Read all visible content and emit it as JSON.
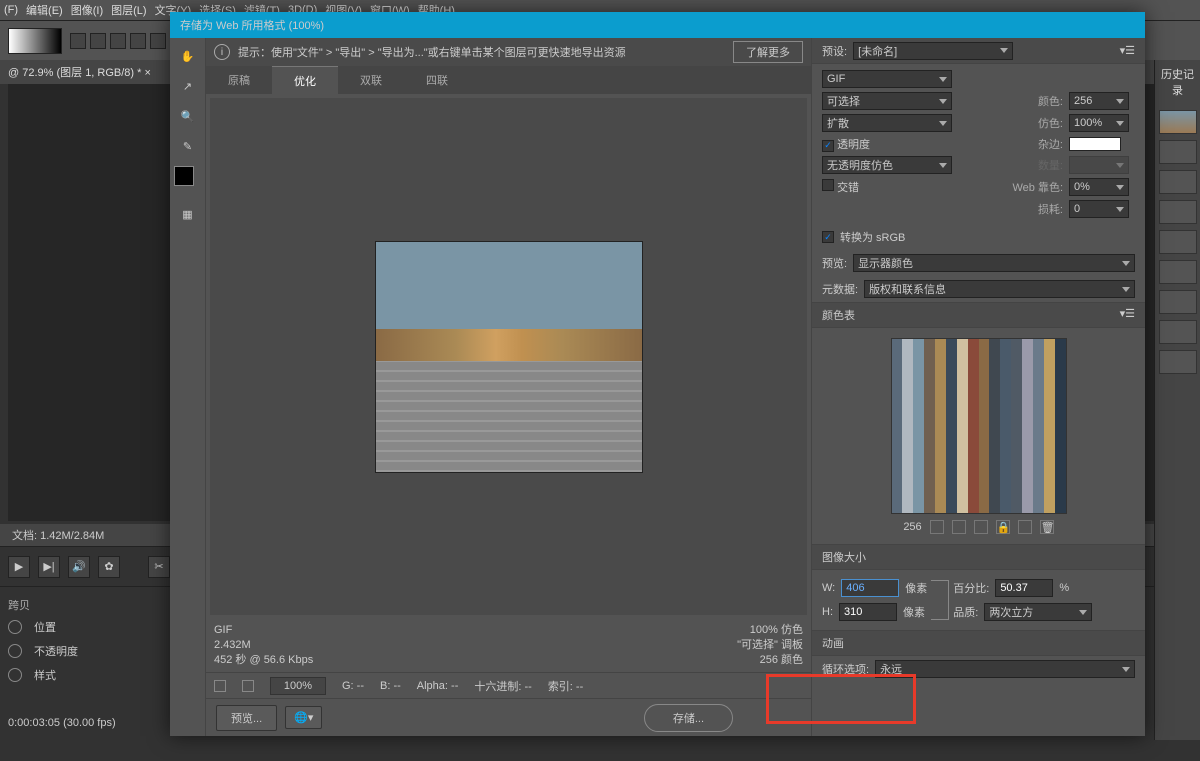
{
  "menubar": {
    "items": [
      "(F)",
      "编辑(E)",
      "图像(I)",
      "图层(L)",
      "文字(Y)",
      "选择(S)",
      "滤镜(T)",
      "3D(D)",
      "视图(V)",
      "窗口(W)",
      "帮助(H)"
    ]
  },
  "doc_tab": "@ 72.9% (图层 1, RGB/8) * ×",
  "status": "文档: 1.42M/2.84M",
  "right_panel_title": "历史记录",
  "timeline": {
    "tab": "跨贝",
    "rows": [
      "位置",
      "不透明度",
      "样式"
    ],
    "time": "0:00:03:05",
    "fps": "(30.00 fps)"
  },
  "dialog": {
    "title": "存储为 Web 所用格式 (100%)",
    "tip": "提示：使用\"文件\" > \"导出\" > \"导出为...\"或右键单击某个图层可更快速地导出资源",
    "learn_more": "了解更多",
    "tabs": [
      "原稿",
      "优化",
      "双联",
      "四联"
    ],
    "active_tab": 1,
    "info": {
      "format": "GIF",
      "size": "2.432M",
      "speed": "452 秒 @ 56.6 Kbps",
      "dither_pct": "100% 仿色",
      "palette": "\"可选择\" 调板",
      "colors": "256 颜色"
    },
    "zoom": "100%",
    "readout": {
      "g": "G: --",
      "b": "B: --",
      "alpha": "Alpha: --",
      "hex": "十六进制: --",
      "index": "索引: --"
    },
    "preview_btn": "预览...",
    "save_btn": "存储..."
  },
  "options": {
    "preset_label": "预设:",
    "preset_value": "[未命名]",
    "format": "GIF",
    "reduction": "可选择",
    "dither_method": "扩散",
    "colors_label": "颜色:",
    "colors": "256",
    "dither_label": "仿色:",
    "dither": "100%",
    "transparency": "透明度",
    "matte_label": "杂边:",
    "trans_dither": "无透明度仿色",
    "amount_label": "数量:",
    "interlace": "交错",
    "web_snap_label": "Web 靠色:",
    "web_snap": "0%",
    "lossy_label": "损耗:",
    "lossy": "0",
    "convert_srgb": "转换为 sRGB",
    "preview_label": "预览:",
    "preview_value": "显示器颜色",
    "metadata_label": "元数据:",
    "metadata_value": "版权和联系信息",
    "color_table_title": "颜色表",
    "color_count": "256",
    "image_size_title": "图像大小",
    "w_label": "W:",
    "w": "406",
    "h_label": "H:",
    "h": "310",
    "px": "像素",
    "percent_label": "百分比:",
    "percent": "50.37",
    "percent_unit": "%",
    "quality_label": "品质:",
    "quality": "两次立方",
    "anim_title": "动画",
    "loop_label": "循环选项:",
    "loop": "永远"
  }
}
